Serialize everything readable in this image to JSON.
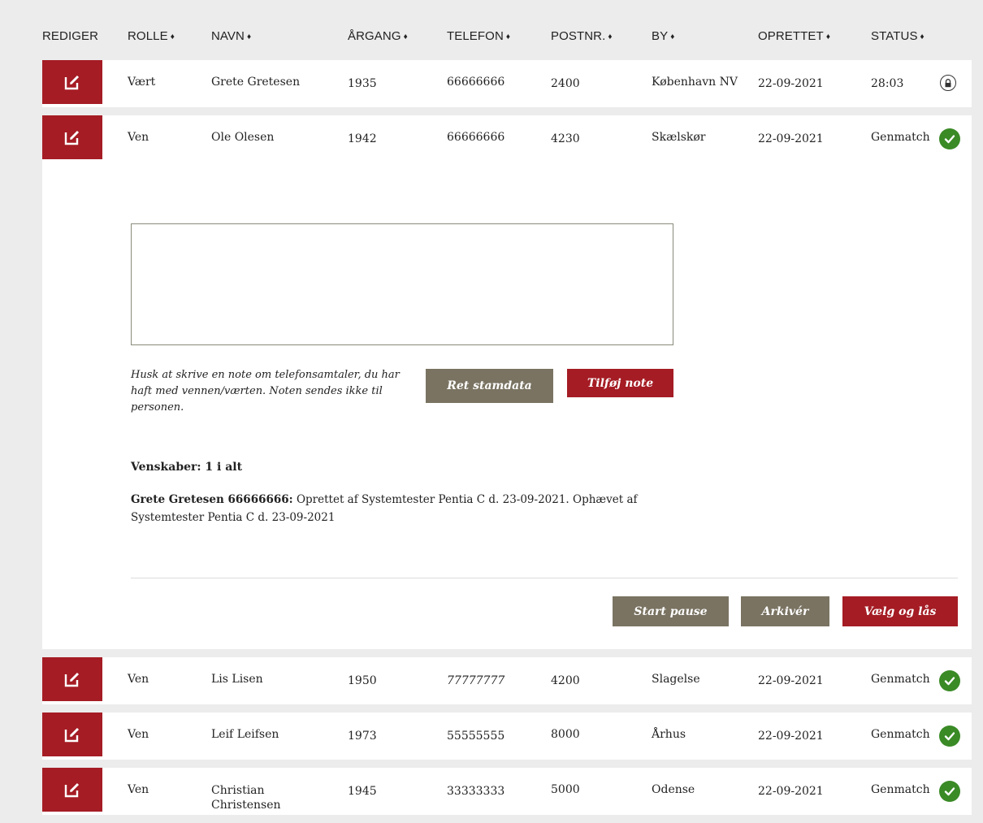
{
  "header": {
    "columns": [
      {
        "label": "REDIGER",
        "sortable": false
      },
      {
        "label": "ROLLE",
        "sortable": true
      },
      {
        "label": "NAVN",
        "sortable": true
      },
      {
        "label": "ÅRGANG",
        "sortable": true
      },
      {
        "label": "TELEFON",
        "sortable": true
      },
      {
        "label": "POSTNR.",
        "sortable": true
      },
      {
        "label": "BY",
        "sortable": true
      },
      {
        "label": "OPRETTET",
        "sortable": true
      },
      {
        "label": "STATUS",
        "sortable": true
      }
    ],
    "sort_glyph": "♦"
  },
  "rows": [
    {
      "rolle": "Vært",
      "navn": "Grete Gretesen",
      "aargang": "1935",
      "telefon": "66666666",
      "postnr": "2400",
      "by": "København NV",
      "oprettet": "22-09-2021",
      "status": "28:03",
      "status_icon": "lock-icon"
    },
    {
      "rolle": "Ven",
      "navn": "Ole Olesen",
      "aargang": "1942",
      "telefon": "66666666",
      "postnr": "4230",
      "by": "Skælskør",
      "oprettet": "22-09-2021",
      "status": "Genmatch",
      "status_icon": "check-icon"
    },
    {
      "rolle": "Ven",
      "navn": "Lis Lisen",
      "aargang": "1950",
      "telefon": "77777777",
      "postnr": "4200",
      "by": "Slagelse",
      "oprettet": "22-09-2021",
      "status": "Genmatch",
      "status_icon": "check-icon"
    },
    {
      "rolle": "Ven",
      "navn": "Leif Leifsen",
      "aargang": "1973",
      "telefon": "55555555",
      "postnr": "8000",
      "by": "Århus",
      "oprettet": "22-09-2021",
      "status": "Genmatch",
      "status_icon": "check-icon"
    },
    {
      "rolle": "Ven",
      "navn": "Christian Christensen",
      "aargang": "1945",
      "telefon": "33333333",
      "postnr": "5000",
      "by": "Odense",
      "oprettet": "22-09-2021",
      "status": "Genmatch",
      "status_icon": "check-icon"
    }
  ],
  "expanded": {
    "note_value": "",
    "hint": "Husk at skrive en note om telefonsamtaler, du har haft med vennen/værten. Noten sendes ikke til personen.",
    "ret_stamdata_label": "Ret stamdata",
    "tilfoej_note_label": "Tilføj note",
    "venskaber_title": "Venskaber: 1 i alt",
    "friendship_who": "Grete Gretesen 66666666:",
    "friendship_text": " Oprettet af Systemtester Pentia C d. 23-09-2021. Ophævet af Systemtester Pentia C d. 23-09-2021",
    "start_pause_label": "Start pause",
    "arkiver_label": "Arkivér",
    "vaelg_og_laas_label": "Vælg og lås"
  },
  "colors": {
    "brand_red": "#a51c24",
    "button_gray": "#7a7362",
    "status_green": "#3a8a26",
    "page_bg": "#ececec"
  }
}
